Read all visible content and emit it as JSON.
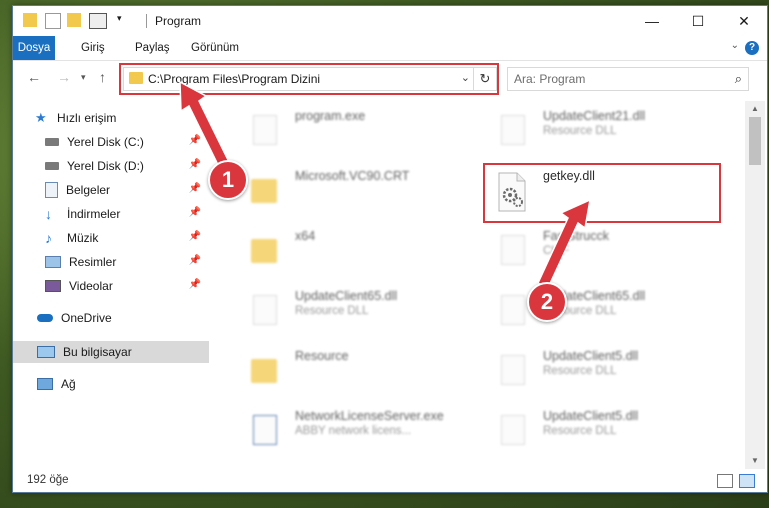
{
  "window": {
    "title": "Program"
  },
  "ribbon": {
    "tabs": [
      "Dosya",
      "Giriş",
      "Paylaş",
      "Görünüm"
    ]
  },
  "navbar": {
    "address": "C:\\Program Files\\Program Dizini",
    "search_placeholder": "Ara: Program"
  },
  "sidebar": {
    "items": [
      {
        "label": "Hızlı erişim",
        "icon": "star-icon"
      },
      {
        "label": "Yerel Disk (C:)",
        "icon": "drive-icon",
        "pinned": true
      },
      {
        "label": "Yerel Disk (D:)",
        "icon": "drive-icon",
        "pinned": true
      },
      {
        "label": "Belgeler",
        "icon": "documents-icon",
        "pinned": true
      },
      {
        "label": "İndirmeler",
        "icon": "download-icon",
        "pinned": true
      },
      {
        "label": "Müzik",
        "icon": "music-icon",
        "pinned": true
      },
      {
        "label": "Resimler",
        "icon": "pictures-icon",
        "pinned": true
      },
      {
        "label": "Videolar",
        "icon": "videos-icon",
        "pinned": true
      },
      {
        "label": "OneDrive",
        "icon": "cloud-icon"
      },
      {
        "label": "Bu bilgisayar",
        "icon": "computer-icon",
        "selected": true
      },
      {
        "label": "Ağ",
        "icon": "network-icon"
      }
    ]
  },
  "files": {
    "left": [
      {
        "name": "program.exe",
        "sub": ""
      },
      {
        "name": "Microsoft.VC90.CRT",
        "sub": ""
      },
      {
        "name": "x64",
        "sub": ""
      },
      {
        "name": "UpdateClient65.dll",
        "sub": "Resource DLL"
      },
      {
        "name": "Resource",
        "sub": ""
      },
      {
        "name": "NetworkLicenseServer.exe",
        "sub": "ABBY network licens..."
      }
    ],
    "right": [
      {
        "name": "UpdateClient21.dll",
        "sub": "Resource DLL"
      },
      {
        "name": "getkey.dll",
        "sub": ""
      },
      {
        "name": "FastStrucck",
        "sub": "CK F"
      },
      {
        "name": "UpdateClient65.dll",
        "sub": "Resource DLL"
      },
      {
        "name": "UpdateClient5.dll",
        "sub": "Resource DLL"
      },
      {
        "name": "UpdateClient5.dll",
        "sub": "Resource DLL"
      }
    ]
  },
  "status": {
    "count": "192 öğe"
  },
  "annotations": {
    "badge1": "1",
    "badge2": "2"
  },
  "colors": {
    "accent": "#1a6fc0",
    "highlight": "#d9363e",
    "folder": "#f2c94c"
  }
}
